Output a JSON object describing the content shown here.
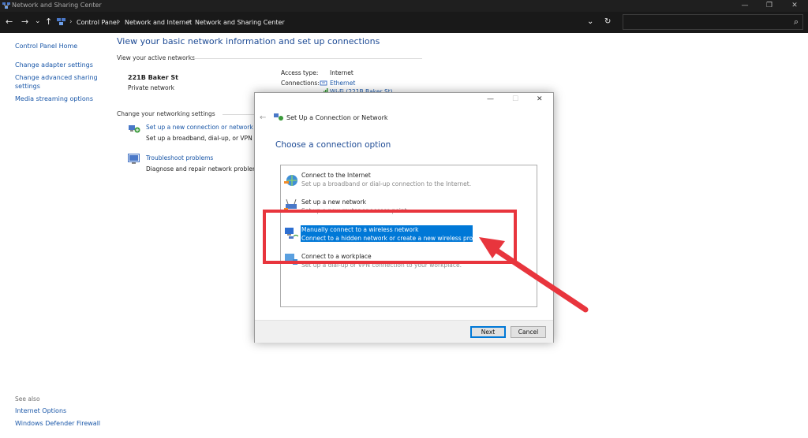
{
  "window": {
    "title": "Network and Sharing Center",
    "controls": {
      "minimize": "—",
      "restore": "❐",
      "close": "✕"
    }
  },
  "addressbar": {
    "crumbs": [
      "Control Panel",
      "Network and Internet",
      "Network and Sharing Center"
    ],
    "nav": {
      "back": "←",
      "forward": "→",
      "down": "⌄",
      "up": "↑"
    },
    "dropdown": "⌄",
    "refresh": "↻",
    "search_placeholder": "",
    "search_icon": "⌕"
  },
  "left_pane": {
    "links": [
      "Control Panel Home",
      "Change adapter settings",
      "Change advanced sharing",
      "settings",
      "Media streaming options"
    ],
    "see_also_label": "See also",
    "see_also_links": [
      "Internet Options",
      "Windows Defender Firewall"
    ]
  },
  "main": {
    "heading": "View your basic network information and set up connections",
    "active_networks_label": "View your active networks",
    "network_name": "221B Baker St",
    "network_type": "Private network",
    "access_type_label": "Access type:",
    "access_type_value": "Internet",
    "connections_label": "Connections:",
    "connection_1": "Ethernet",
    "connection_2": "Wi-Fi (221B Baker St)",
    "change_settings_label": "Change your networking settings",
    "setup_link": "Set up a new connection or network",
    "setup_desc": "Set up a broadband, dial-up, or VPN co",
    "troubleshoot_link": "Troubleshoot problems",
    "troubleshoot_desc": "Diagnose and repair network problems"
  },
  "dialog": {
    "title": "Set Up a Connection or Network",
    "back": "←",
    "controls": {
      "minimize": "—",
      "maximize": "☐",
      "close": "✕"
    },
    "heading": "Choose a connection option",
    "options": [
      {
        "title": "Connect to the Internet",
        "desc": "Set up a broadband or dial-up connection to the Internet."
      },
      {
        "title": "Set up a new network",
        "desc": "Set up a new router or access point."
      },
      {
        "title": "Manually connect to a wireless network",
        "desc": "Connect to a hidden network or create a new wireless profile."
      },
      {
        "title": "Connect to a workplace",
        "desc": "Set up a dial-up or VPN connection to your workplace."
      }
    ],
    "selected_index": 2,
    "next_label": "Next",
    "cancel_label": "Cancel"
  },
  "colors": {
    "accent": "#0078d7",
    "link": "#1a57a8",
    "annotation": "#e8353d"
  }
}
